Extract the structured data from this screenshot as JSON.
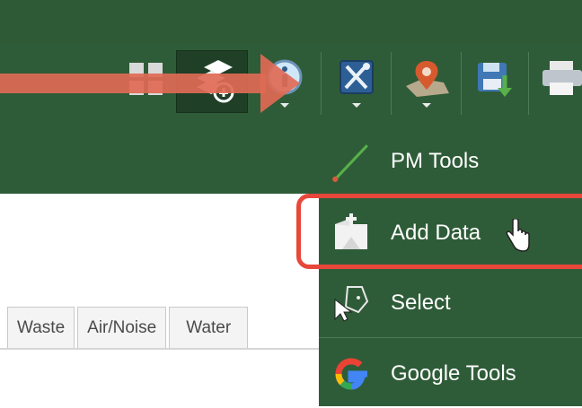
{
  "toolbar": {
    "tools": [
      {
        "name": "grid-icon"
      },
      {
        "name": "add-layer-icon"
      },
      {
        "name": "identify-info-icon"
      },
      {
        "name": "tools-icon"
      },
      {
        "name": "location-pin-icon"
      },
      {
        "name": "save-download-icon"
      },
      {
        "name": "print-icon"
      }
    ]
  },
  "tabs": [
    "Waste",
    "Air/Noise",
    "Water"
  ],
  "menu": {
    "items": [
      {
        "label": "PM Tools",
        "icon": "pm-tools-line-icon"
      },
      {
        "label": "Add Data",
        "icon": "add-data-icon"
      },
      {
        "label": "Select",
        "icon": "select-icon"
      },
      {
        "label": "Google Tools",
        "icon": "google-g-icon"
      }
    ]
  },
  "colors": {
    "toolbar_green": "#2f5c38",
    "active_green": "#1f3f26",
    "highlight_red": "#e8473b",
    "arrow_red": "#e06a55"
  }
}
